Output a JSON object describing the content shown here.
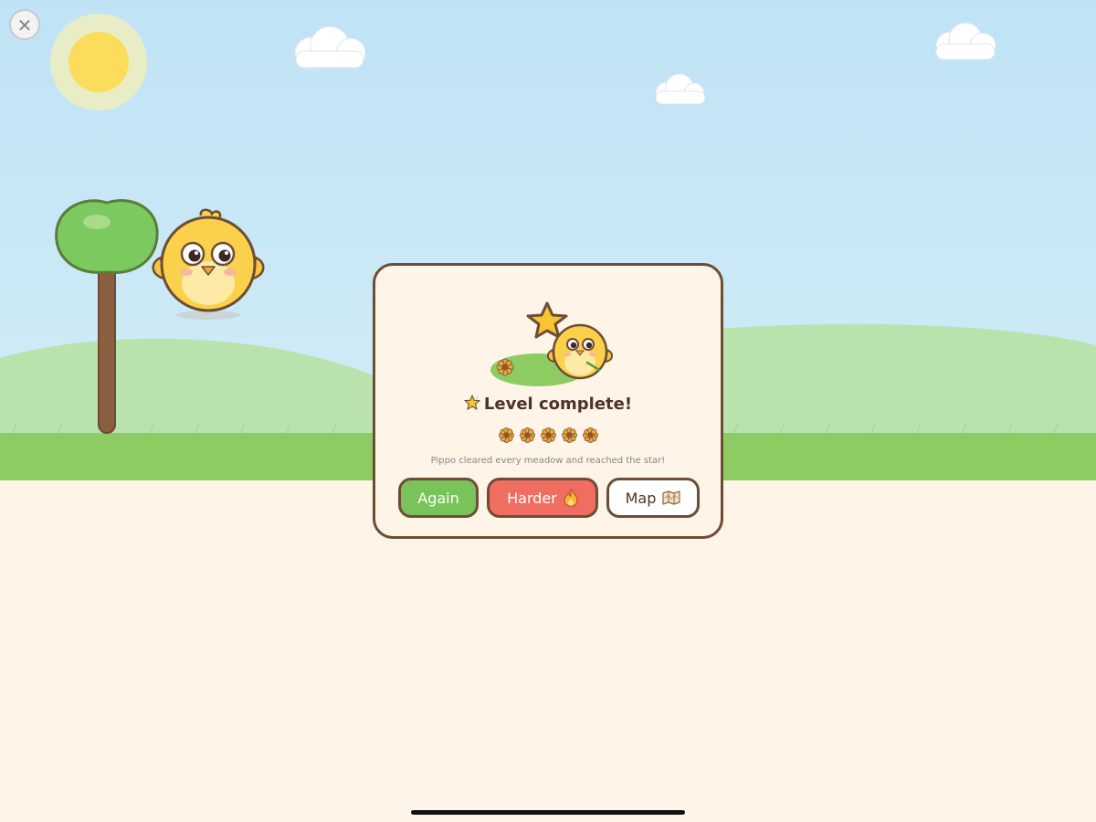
{
  "close_button": {
    "label": "×",
    "icon": "close-icon"
  },
  "dialog": {
    "title": "Level complete!",
    "title_icon": "star-icon",
    "rewards": {
      "earned": 5,
      "icon": "sunflower-icon"
    },
    "subtitle": "Pippo cleared every meadow and reached the star!",
    "buttons": {
      "again": "Again",
      "harder": "Harder",
      "harder_icon": "flame-icon",
      "map": "Map",
      "map_icon": "map-icon"
    }
  },
  "colors": {
    "sky": "#bfe3f5",
    "grass": "#8ccc63",
    "hill": "#b9e2ad",
    "ground": "#fef4e8",
    "outline": "#6e4d35",
    "again": "#79c45a",
    "harder": "#f06e61",
    "chick": "#fbd14b"
  }
}
